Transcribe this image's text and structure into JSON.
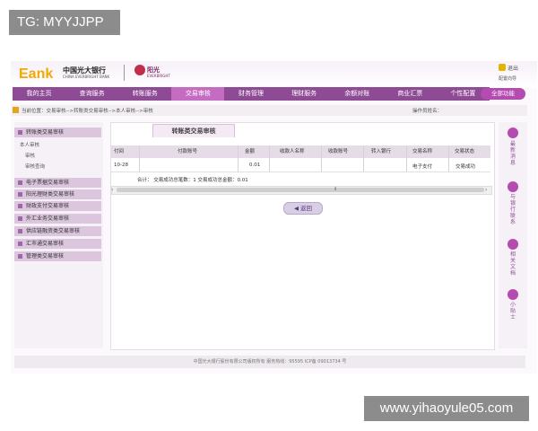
{
  "watermark": {
    "top_left": "TG: MYYJJPP",
    "bottom_right": "www.yihaoyule05.com"
  },
  "header": {
    "logo": "Eank",
    "bank_name_cn": "中国光大银行",
    "bank_name_en": "CHINA EVERBRIGHT BANK",
    "partner_name": "阳光",
    "partner_sub": "EVERBRIGHT",
    "exit_label": "退出",
    "config_label": "配置向导"
  },
  "nav": {
    "items": [
      "我的主页",
      "查询服务",
      "转账服务",
      "交易审核",
      "财务管理",
      "理财服务",
      "余额对账",
      "商业汇票",
      "个性配置"
    ],
    "active_index": 3,
    "all_functions": "全部功能"
  },
  "breadcrumb": {
    "text": "当前位置：交易审核-->转账类交易审核-->本人审核-->审核",
    "operator_label": "操作员姓名："
  },
  "sidebar": {
    "sections": [
      {
        "label": "转账类交易审核"
      },
      {
        "label": "本人审核"
      },
      {
        "label": "审核"
      },
      {
        "label": "审核查询"
      },
      {
        "label": "电子票据交易审核"
      },
      {
        "label": "阳光理财类交易审核"
      },
      {
        "label": "财政支付交易审核"
      },
      {
        "label": "外汇业务交易审核"
      },
      {
        "label": "供应链融资类交易审核"
      },
      {
        "label": "汇市通交易审核"
      },
      {
        "label": "管理类交易审核"
      }
    ]
  },
  "main": {
    "tab_title": "转账类交易审核",
    "columns": [
      "付间",
      "付款账号",
      "金额",
      "收款人名称",
      "收款账号",
      "转入银行",
      "交易名称",
      "交易状态"
    ],
    "rows": [
      [
        "10-28",
        "",
        "0.01",
        "",
        "",
        "",
        "电子支付",
        "交易成功"
      ]
    ],
    "total": "合计：  交易成功总笔数：1   交易成功总金额：0.01",
    "back_button": "返回"
  },
  "right_rail": {
    "items": [
      "最新消息",
      "与银行联系",
      "相关文档",
      "小贴士"
    ]
  },
  "footer": {
    "text": "中国光大银行股份有限公司版权所有 服务热线：95595  ICP备 09013734 号"
  }
}
